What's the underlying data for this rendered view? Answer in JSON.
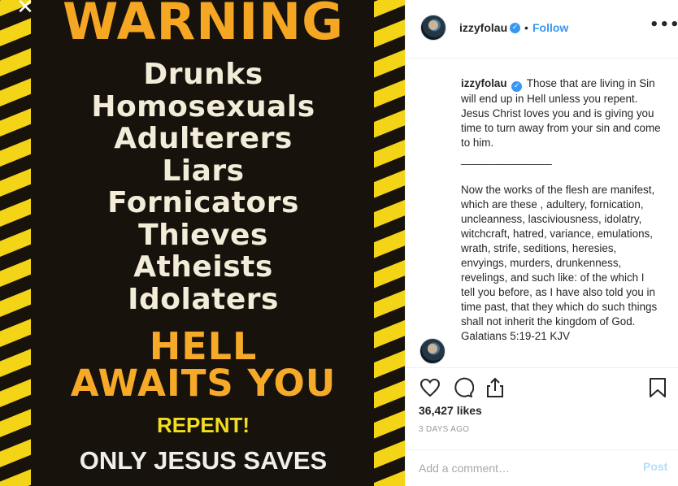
{
  "poster": {
    "close_glyph": "✕",
    "warning": "WARNING",
    "sinners": [
      "Drunks",
      "Homosexuals",
      "Adulterers",
      "Liars",
      "Fornicators",
      "Thieves",
      "Atheists",
      "Idolaters"
    ],
    "hell_line1": "HELL",
    "hell_line2": "AWAITS YOU",
    "repent": "REPENT!",
    "saves": "ONLY JESUS SAVES",
    "colors": {
      "background": "#17120c",
      "stripe": "#f3d417",
      "orange": "#f5a623",
      "cream": "#f2ecd9"
    }
  },
  "header": {
    "username": "izzyfolau",
    "verified_glyph": "✓",
    "dot": "•",
    "follow_label": "Follow",
    "more_glyph": "•••"
  },
  "caption": {
    "username": "izzyfolau",
    "verified_glyph": "✓",
    "paragraph1": "Those that are living in Sin will end up in Hell unless you repent. Jesus Christ loves you and is giving you time to turn away from your sin and come to him.",
    "divider": "_______________",
    "paragraph2": "Now the works of the flesh are manifest, which are these , adultery, fornication, uncleanness, lasciviousness, idolatry, witchcraft, hatred, variance, emulations, wrath, strife, seditions, heresies, envyings, murders, drunkenness, revelings, and such like: of the which I tell you before, as I have also told you in time past, that they which do such things shall not inherit the kingdom of God. Galatians 5:19-21 KJV"
  },
  "actions": {
    "icons": [
      "heart-icon",
      "comment-icon",
      "share-icon",
      "bookmark-icon"
    ],
    "likes": "36,427 likes",
    "time": "3 DAYS AGO"
  },
  "comment": {
    "placeholder": "Add a comment…",
    "post_label": "Post"
  },
  "colors": {
    "accent": "#3897f0",
    "post_disabled": "#b2dffc",
    "border": "#efefef"
  }
}
